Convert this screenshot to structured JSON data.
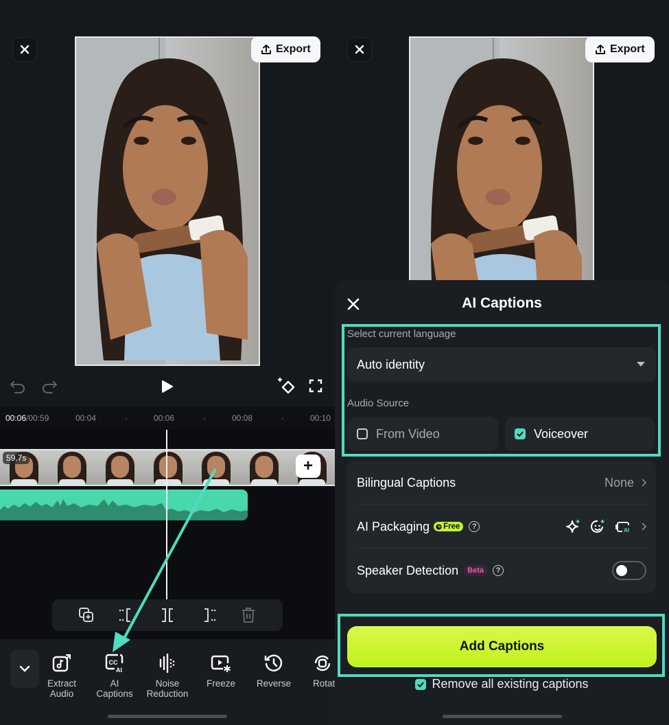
{
  "left": {
    "export_label": "Export",
    "timecode_current": "00:06",
    "timecode_total": "/00:59",
    "ruler_ticks": [
      "00:04",
      "00:06",
      "00:08",
      "00:10"
    ],
    "clip_duration": "59.7s",
    "add_clip_label": "+",
    "tools": [
      {
        "label": "Extract\nAudio",
        "icon": "extract-audio-icon"
      },
      {
        "label": "AI\nCaptions",
        "icon": "ai-captions-icon"
      },
      {
        "label": "Noise\nReduction",
        "icon": "noise-reduction-icon"
      },
      {
        "label": "Freeze",
        "icon": "freeze-icon"
      },
      {
        "label": "Reverse",
        "icon": "reverse-icon"
      },
      {
        "label": "Rotat",
        "icon": "rotate-icon"
      }
    ]
  },
  "right": {
    "export_label": "Export",
    "sheet_title": "AI Captions",
    "language_label": "Select current language",
    "language_value": "Auto identity",
    "audio_source_label": "Audio Source",
    "audio_sources": [
      {
        "label": "From Video",
        "checked": false
      },
      {
        "label": "Voiceover",
        "checked": true
      }
    ],
    "settings": [
      {
        "label": "Bilingual Captions",
        "value": "None"
      },
      {
        "label": "AI Packaging",
        "badge": "Free"
      },
      {
        "label": "Speaker Detection",
        "badge": "Beta",
        "toggle": false
      }
    ],
    "add_captions_label": "Add Captions",
    "remove_existing_label": "Remove all existing captions",
    "remove_existing_checked": true
  },
  "colors": {
    "accent_teal": "#4fdcc0",
    "cta_lime": "#c6f233",
    "audio_track": "#48d8ac",
    "beta_pink": "#e25cb7"
  }
}
